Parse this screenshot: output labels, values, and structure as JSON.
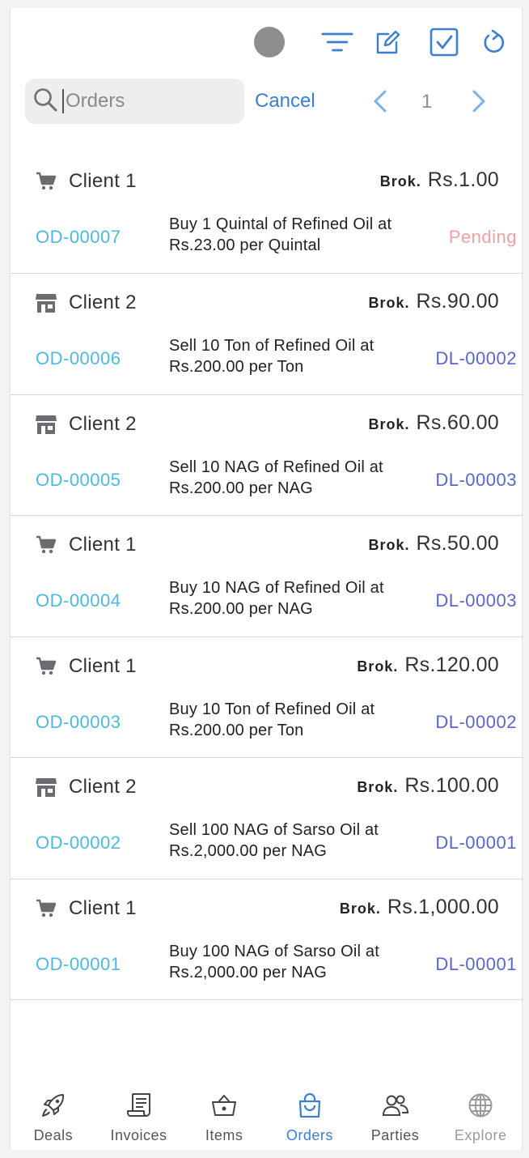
{
  "toolbar": {
    "icons": [
      "avatar-dot",
      "filter-icon",
      "compose-icon",
      "checkbox-icon",
      "refresh-icon"
    ]
  },
  "search": {
    "placeholder": "Orders",
    "value": "",
    "cancel_label": "Cancel"
  },
  "pager": {
    "current_page": "1"
  },
  "colors": {
    "accent": "#3a7fd5",
    "order_id": "#4cbadf",
    "deal_id": "#5866d0",
    "pending": "#f0a1a8"
  },
  "orders": [
    {
      "type": "buy",
      "client": "Client 1",
      "brok_label": "Brok.",
      "brokerage": "Rs.1.00",
      "id": "OD-00007",
      "desc_line1": "Buy 1 Quintal of Refined Oil at",
      "desc_line2": "Rs.23.00 per Quintal",
      "status": "Pending",
      "deal": ""
    },
    {
      "type": "sell",
      "client": "Client 2",
      "brok_label": "Brok.",
      "brokerage": "Rs.90.00",
      "id": "OD-00006",
      "desc_line1": "Sell 10 Ton of Refined Oil at",
      "desc_line2": "Rs.200.00 per Ton",
      "status": "",
      "deal": "DL-00002"
    },
    {
      "type": "sell",
      "client": "Client 2",
      "brok_label": "Brok.",
      "brokerage": "Rs.60.00",
      "id": "OD-00005",
      "desc_line1": "Sell 10 NAG of Refined Oil at",
      "desc_line2": "Rs.200.00 per NAG",
      "status": "",
      "deal": "DL-00003"
    },
    {
      "type": "buy",
      "client": "Client 1",
      "brok_label": "Brok.",
      "brokerage": "Rs.50.00",
      "id": "OD-00004",
      "desc_line1": "Buy 10 NAG of Refined Oil at",
      "desc_line2": "Rs.200.00 per NAG",
      "status": "",
      "deal": "DL-00003"
    },
    {
      "type": "buy",
      "client": "Client 1",
      "brok_label": "Brok.",
      "brokerage": "Rs.120.00",
      "id": "OD-00003",
      "desc_line1": "Buy 10 Ton of Refined Oil at",
      "desc_line2": "Rs.200.00 per Ton",
      "status": "",
      "deal": "DL-00002"
    },
    {
      "type": "sell",
      "client": "Client 2",
      "brok_label": "Brok.",
      "brokerage": "Rs.100.00",
      "id": "OD-00002",
      "desc_line1": "Sell 100 NAG of Sarso Oil at",
      "desc_line2": "Rs.2,000.00 per NAG",
      "status": "",
      "deal": "DL-00001"
    },
    {
      "type": "buy",
      "client": "Client 1",
      "brok_label": "Brok.",
      "brokerage": "Rs.1,000.00",
      "id": "OD-00001",
      "desc_line1": "Buy 100 NAG of Sarso Oil at",
      "desc_line2": "Rs.2,000.00 per NAG",
      "status": "",
      "deal": "DL-00001"
    }
  ],
  "tabs": [
    {
      "label": "Deals",
      "icon": "rocket-icon",
      "state": "normal"
    },
    {
      "label": "Invoices",
      "icon": "receipt-icon",
      "state": "normal"
    },
    {
      "label": "Items",
      "icon": "basket-icon",
      "state": "normal"
    },
    {
      "label": "Orders",
      "icon": "bag-icon",
      "state": "active"
    },
    {
      "label": "Parties",
      "icon": "people-icon",
      "state": "normal"
    },
    {
      "label": "Explore",
      "icon": "globe-icon",
      "state": "disabled"
    }
  ]
}
